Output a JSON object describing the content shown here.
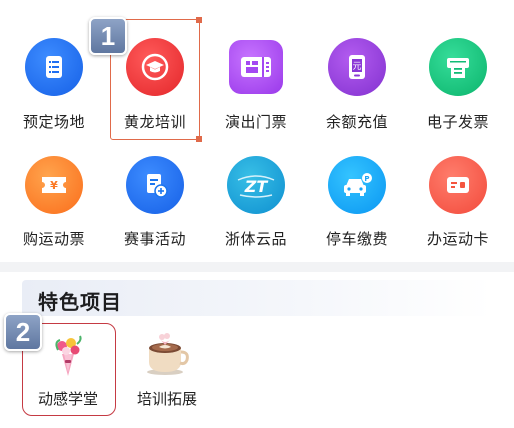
{
  "grid": {
    "row1": [
      {
        "label": "预定场地",
        "icon": "list-doc-icon",
        "color": "#1f6ef2"
      },
      {
        "label": "黄龙培训",
        "icon": "graduation-cap-icon",
        "color": "#ea3336"
      },
      {
        "label": "演出门票",
        "icon": "ticket-icon",
        "color": "#a448f2"
      },
      {
        "label": "余额充值",
        "icon": "wallet-recharge-icon",
        "color": "#8a38d6"
      },
      {
        "label": "电子发票",
        "icon": "invoice-printer-icon",
        "color": "#12bb76"
      }
    ],
    "row2": [
      {
        "label": "购运动票",
        "icon": "yuan-ticket-icon",
        "color": "#fb7a26"
      },
      {
        "label": "赛事活动",
        "icon": "event-add-icon",
        "color": "#1c76ee"
      },
      {
        "label": "浙体云品",
        "icon": "zt-logo-icon",
        "color": "#1497d6"
      },
      {
        "label": "停车缴费",
        "icon": "car-parking-icon",
        "color": "#1ba3f5"
      },
      {
        "label": "办运动卡",
        "icon": "sport-card-icon",
        "color": "#f4553f"
      }
    ]
  },
  "annotations": {
    "badge1": "1",
    "badge2": "2",
    "highlight_color": "#e06a4a",
    "highlight2_color": "#c53a43"
  },
  "featured": {
    "title": "特色项目",
    "items": [
      {
        "label": "动感学堂",
        "icon": "flower-bouquet-icon"
      },
      {
        "label": "培训拓展",
        "icon": "coffee-cup-icon"
      }
    ]
  }
}
